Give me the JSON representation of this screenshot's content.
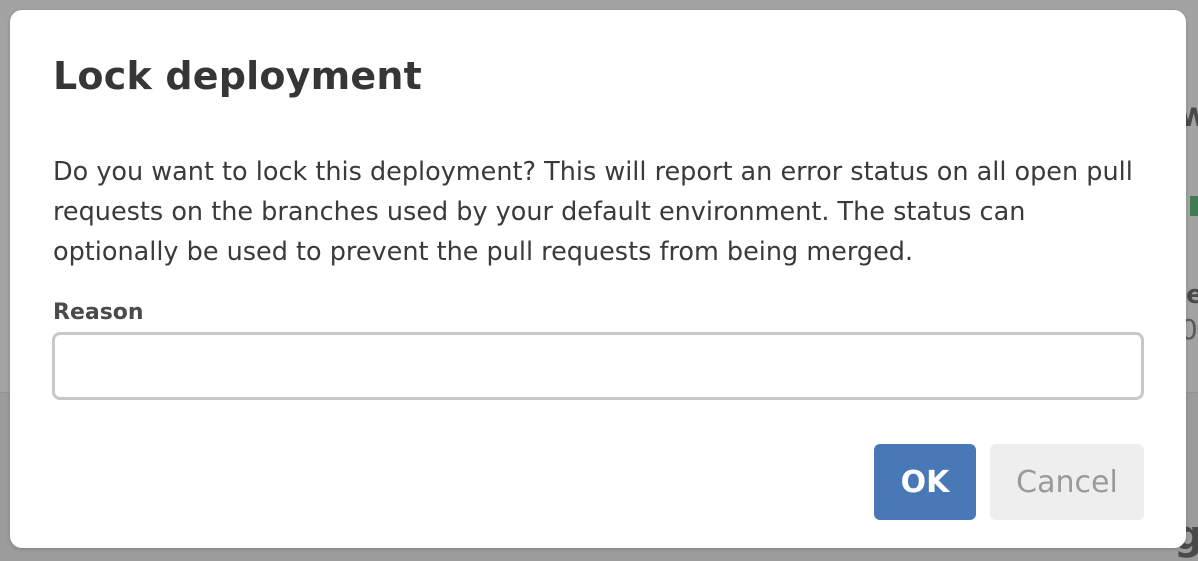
{
  "dialog": {
    "title": "Lock deployment",
    "message": "Do you want to lock this deployment? This will report an error status on all open pull requests on the branches used by your default environment. The status can optionally be used to prevent the pull requests from being merged.",
    "reason_label": "Reason",
    "reason_value": "",
    "ok_label": "OK",
    "cancel_label": "Cancel"
  },
  "background": {
    "fragment_1": "w",
    "fragment_2": "e",
    "fragment_3": "0",
    "fragment_4": "g"
  },
  "colors": {
    "primary_button": "#4878b6",
    "cancel_button": "#eeeeee",
    "overlay": "#a3a3a3"
  }
}
